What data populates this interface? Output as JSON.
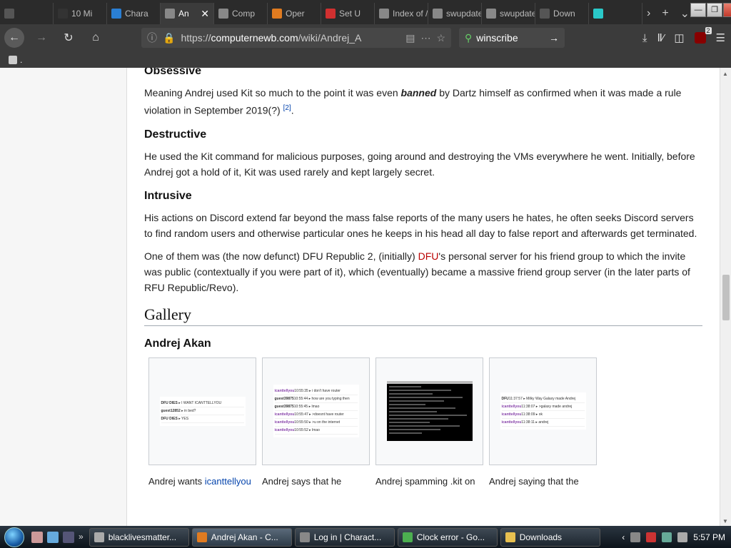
{
  "tabs": [
    {
      "label": "",
      "color": "#555"
    },
    {
      "label": "10 Mi",
      "color": "#333"
    },
    {
      "label": "Chara",
      "color": "#2a7fd4"
    },
    {
      "label": "An",
      "color": "#888",
      "active": true
    },
    {
      "label": "Comp",
      "color": "#888"
    },
    {
      "label": "Oper",
      "color": "#e07b20"
    },
    {
      "label": "Set U",
      "color": "#d03030"
    },
    {
      "label": "Index of /",
      "color": "#888"
    },
    {
      "label": "swupdate",
      "color": "#888"
    },
    {
      "label": "swupdate",
      "color": "#888"
    },
    {
      "label": "Down",
      "color": "#555"
    },
    {
      "label": "",
      "color": "#2ac9c9"
    }
  ],
  "nav": {
    "url_prefix": "https://",
    "url_domain": "computernewb.com",
    "url_path": "/wiki/Andrej_A",
    "search_query": "winscribe",
    "ublock_count": "2"
  },
  "bookmarks": {
    "label": "."
  },
  "article": {
    "obsessive_heading": "Obsessive",
    "obsessive_text_1": "Meaning Andrej used Kit so much to the point it was even ",
    "obsessive_bold": "banned",
    "obsessive_text_2": " by Dartz himself as confirmed when it was made a rule violation in September 2019(?) ",
    "obsessive_ref": "[2]",
    "destructive_heading": "Destructive",
    "destructive_text": "He used the Kit command for malicious purposes, going around and destroying the VMs everywhere he went. Initially, before Andrej got a hold of it, Kit was used rarely and kept largely secret.",
    "intrusive_heading": "Intrusive",
    "intrusive_text": "His actions on Discord extend far beyond the mass false reports of the many users he hates, he often seeks Discord servers to find random users and otherwise particular ones he keeps in his head all day to false report and afterwards get terminated.",
    "intrusive2_text_1": "One of them was (the now defunct) DFU Republic 2, (initially) ",
    "intrusive2_link": "DFU",
    "intrusive2_text_2": "'s personal server for his friend group to which the invite was public (contextually if you were part of it), which (eventually) became a massive friend group server (in the later parts of RFU Republic/Revo).",
    "gallery_heading": "Gallery",
    "gallery_sub": "Andrej Akan",
    "gallery": [
      {
        "caption_text": "Andrej wants ",
        "caption_link": "icanttellyou",
        "rows": [
          {
            "user": "DFU DIES",
            "time": "",
            "msg": "I WANT ICANTTELLYOU"
          },
          {
            "user": "guest12852",
            "time": "",
            "msg": "in bed?"
          },
          {
            "user": "DFU DIES",
            "time": "",
            "msg": "YES"
          }
        ]
      },
      {
        "caption_text": "Andrej says that he",
        "caption_link": "",
        "rows": [
          {
            "user": "icanttellyou",
            "time": "10:55:35",
            "msg": "i don't have router",
            "purple": true
          },
          {
            "user": "guest39875",
            "time": "10:55:44",
            "msg": "how are you typing then"
          },
          {
            "user": "guest39875",
            "time": "10:55:45",
            "msg": "lmao"
          },
          {
            "user": "icanttellyou",
            "time": "10:55:47",
            "msg": ">doesnt have router",
            "purple": true
          },
          {
            "user": "icanttellyou",
            "time": "10:55:50",
            "msg": ">u on the internet",
            "purple": true
          },
          {
            "user": "icanttellyou",
            "time": "10:55:52",
            "msg": "lmao",
            "purple": true
          }
        ]
      },
      {
        "caption_text": "Andrej spamming .kit on",
        "caption_link": "",
        "rows": []
      },
      {
        "caption_text": "Andrej saying that the",
        "caption_link": "",
        "rows": [
          {
            "user": "DFU",
            "time": "11:37:57",
            "msg": "Milky Way Galaxy made Andrej"
          },
          {
            "user": "icanttellyou",
            "time": "11:38:07",
            "msg": ">galaxy made andrej",
            "purple": true
          },
          {
            "user": "icanttellyou",
            "time": "11:38:09",
            "msg": "ok",
            "purple": true
          },
          {
            "user": "icanttellyou",
            "time": "11:38:11",
            "msg": "andrej",
            "purple": true
          }
        ]
      }
    ]
  },
  "taskbar": {
    "buttons": [
      {
        "label": "blacklivesmatter...",
        "color": "#aaa"
      },
      {
        "label": "Andrej Akan - C...",
        "color": "#e07b20",
        "active": true
      },
      {
        "label": "Log in | Charact...",
        "color": "#888"
      },
      {
        "label": "Clock error - Go...",
        "color": "#4caf50"
      },
      {
        "label": "Downloads",
        "color": "#e8c050"
      }
    ],
    "clock": "5:57 PM"
  }
}
